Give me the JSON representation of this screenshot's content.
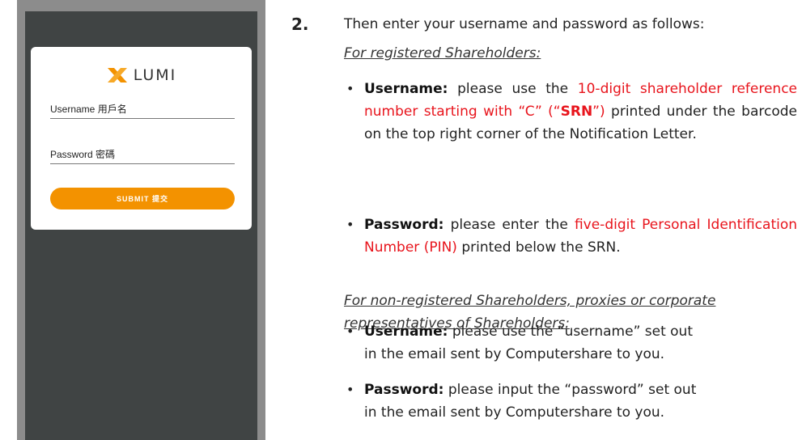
{
  "login": {
    "logo_text": "LUMI",
    "username_label": "Username 用戶名",
    "password_label": "Password 密碼",
    "submit_label": "SUBMIT 提交",
    "colors": {
      "accent": "#f39200",
      "screen": "#404444",
      "frame": "#8c8c8c"
    }
  },
  "instructions": {
    "step_number": "2.",
    "step_text": "Then enter your username and password as follows:",
    "registered": {
      "heading": "For registered Shareholders:",
      "username": {
        "label": "Username:",
        "pre": " please use the ",
        "red1": "10-digit shareholder reference number starting with “C” (“",
        "srn": "SRN",
        "red2": "”)",
        "post": " printed under the barcode on the top right corner of the Notification Letter."
      },
      "password": {
        "label": "Password:",
        "pre": " please enter the ",
        "red": "five-digit Personal Identification Number (PIN)",
        "post": " printed below the SRN."
      }
    },
    "non_registered": {
      "heading": "For non-registered Shareholders, proxies or corporate representatives of Shareholders:",
      "username": {
        "label": "Username:",
        "text": " please use the “username” set out in the email sent by Computershare to you."
      },
      "password": {
        "label": "Password:",
        "text": " please input the “password” set out in the email sent by Computershare to you."
      }
    },
    "bullet_char": "•",
    "colors": {
      "highlight": "#e8141c"
    }
  }
}
